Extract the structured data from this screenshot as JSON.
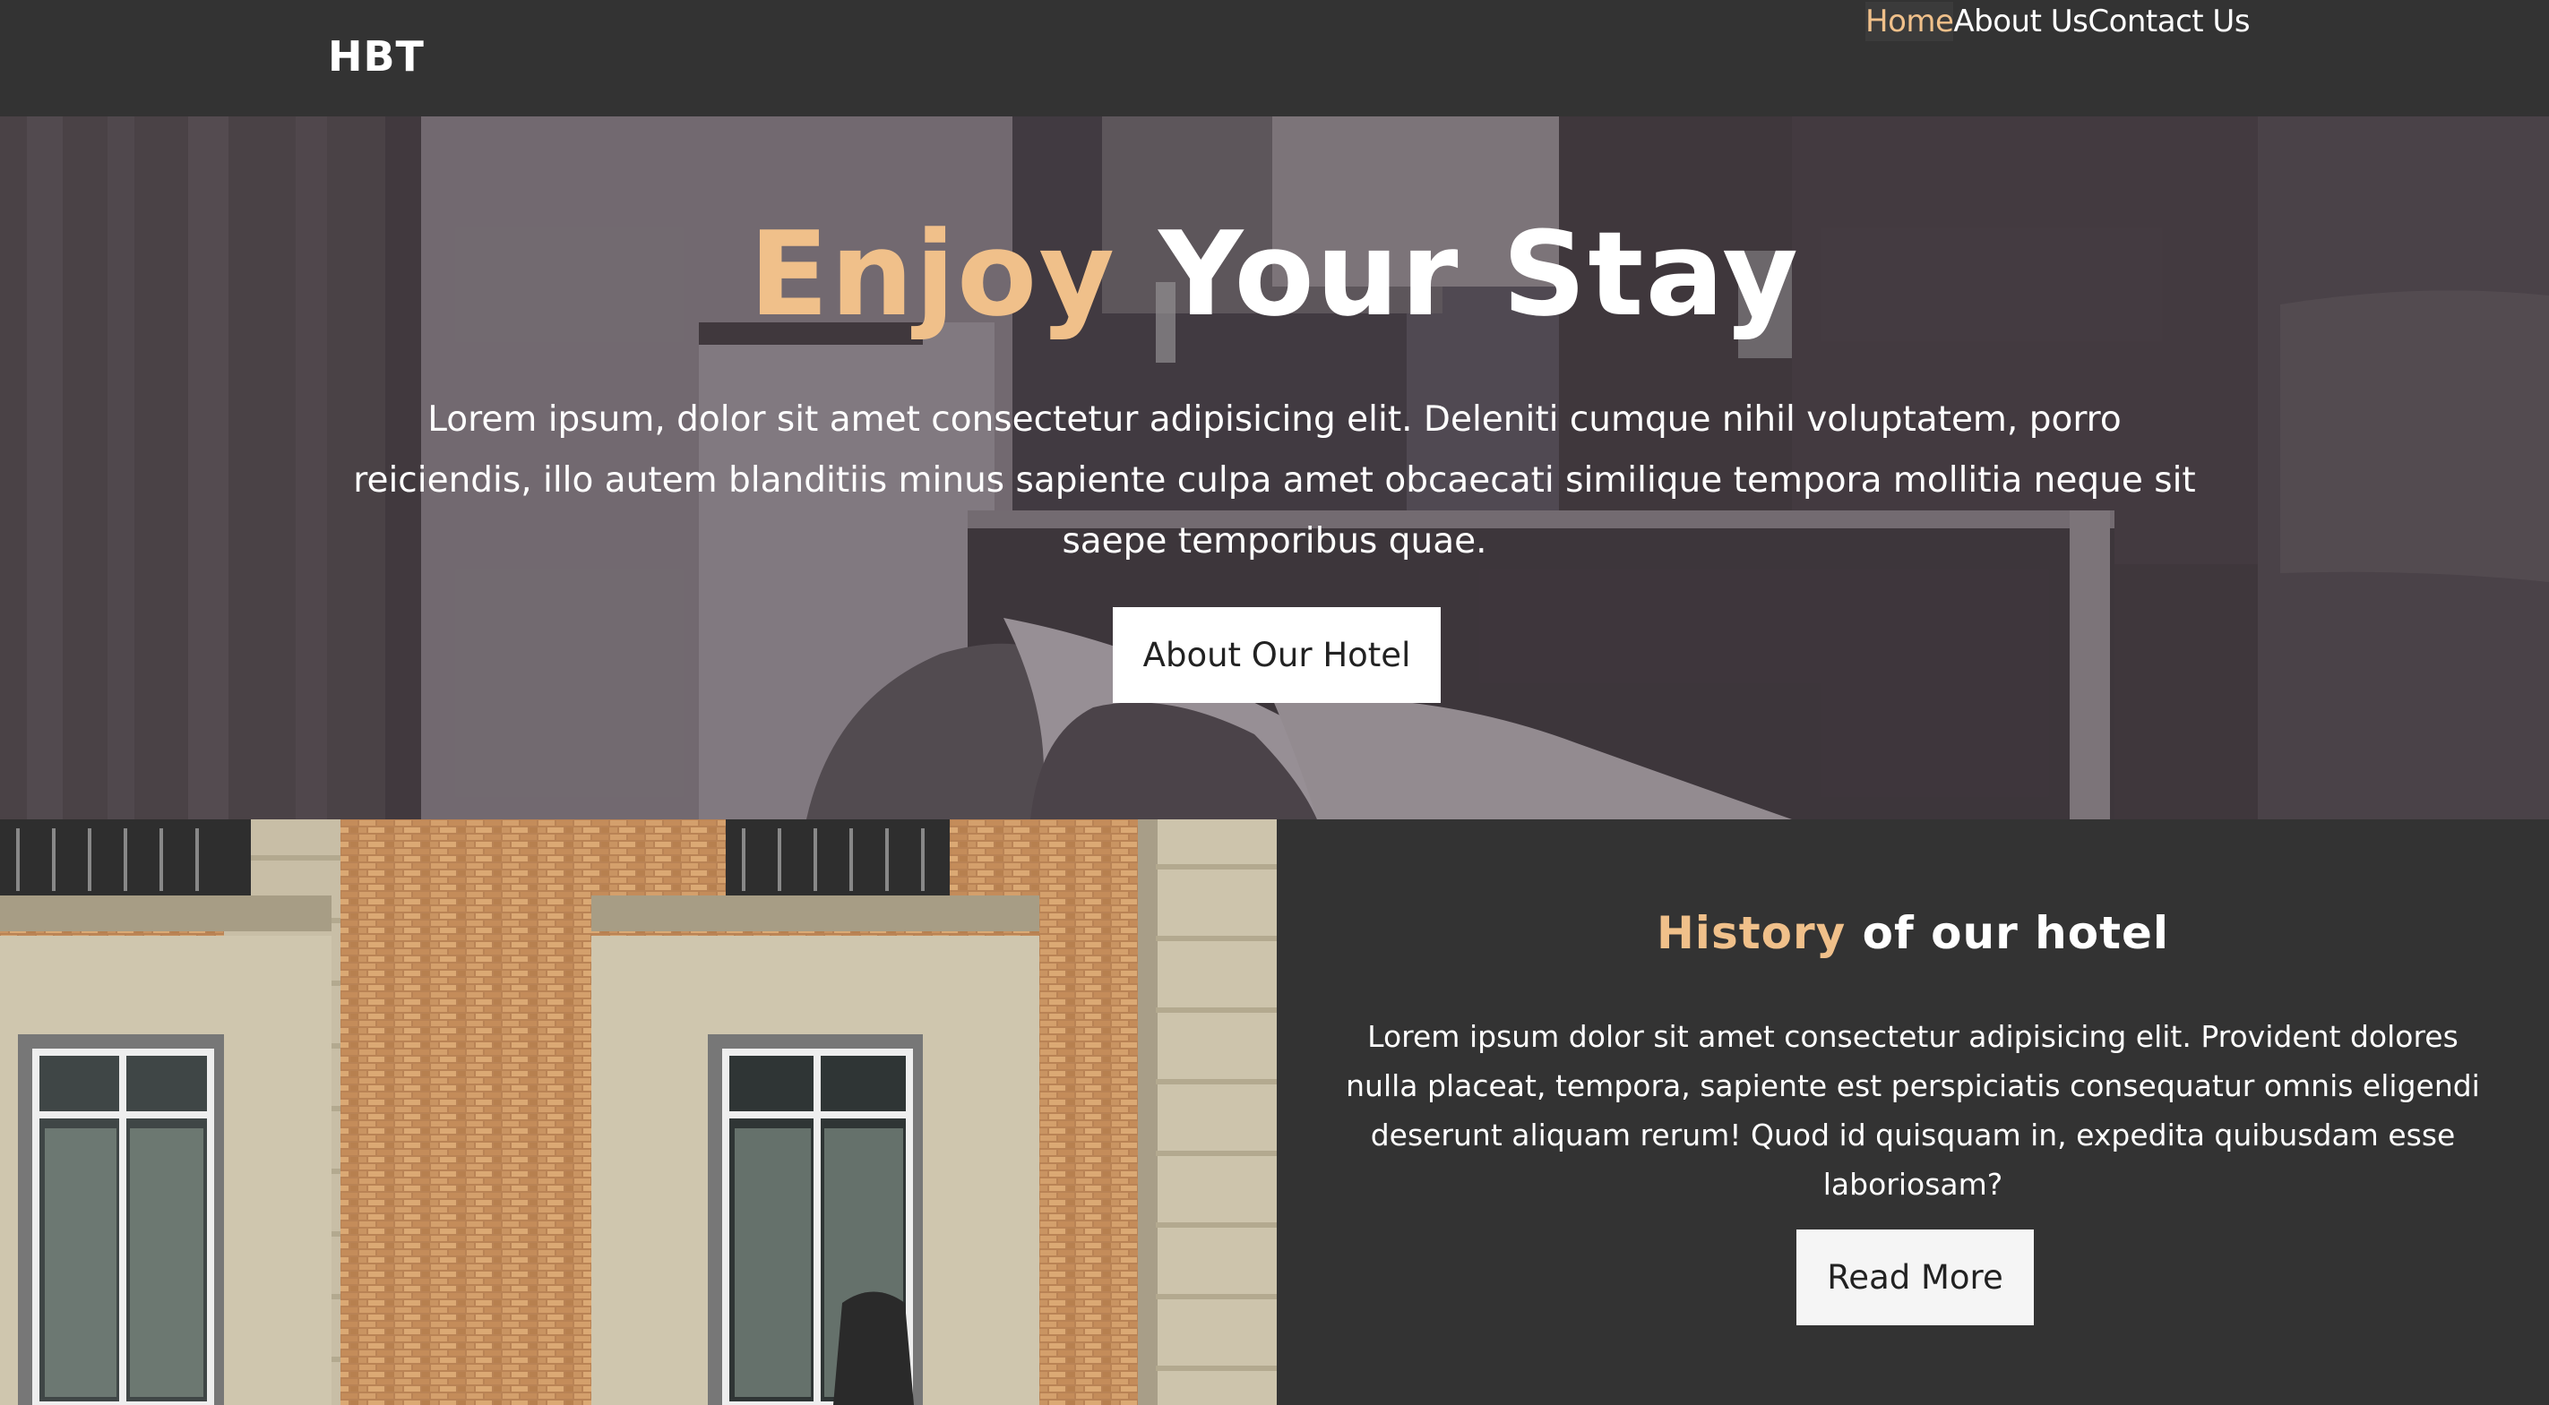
{
  "nav": {
    "brand": "HBT",
    "links": [
      {
        "label": "Home",
        "active": true
      },
      {
        "label": "About Us",
        "active": false
      },
      {
        "label": "Contact Us",
        "active": false
      }
    ]
  },
  "hero": {
    "title_accent": "Enjoy",
    "title_rest": " Your Stay",
    "text": "Lorem ipsum, dolor sit amet consectetur adipisicing elit. Deleniti cumque nihil voluptatem, porro reiciendis, illo autem blanditiis minus sapiente culpa amet obcaecati similique tempora mollitia neque sit saepe temporibus quae.",
    "button_label": "About Our Hotel",
    "background_image": "hotel-room-photo"
  },
  "history": {
    "title_accent": "History",
    "title_rest": " of our hotel",
    "text": "Lorem ipsum dolor sit amet consectetur adipisicing elit. Provident dolores nulla placeat, tempora, sapiente est perspiciatis consequatur omnis eligendi deserunt aliquam rerum! Quod id quisquam in, expedita quibusdam esse laboriosam?",
    "button_label": "Read More",
    "image": "hotel-facade-photo"
  },
  "colors": {
    "background": "#333333",
    "accent": "#f0c08a",
    "text": "#ffffff",
    "button_bg": "#ffffff"
  }
}
